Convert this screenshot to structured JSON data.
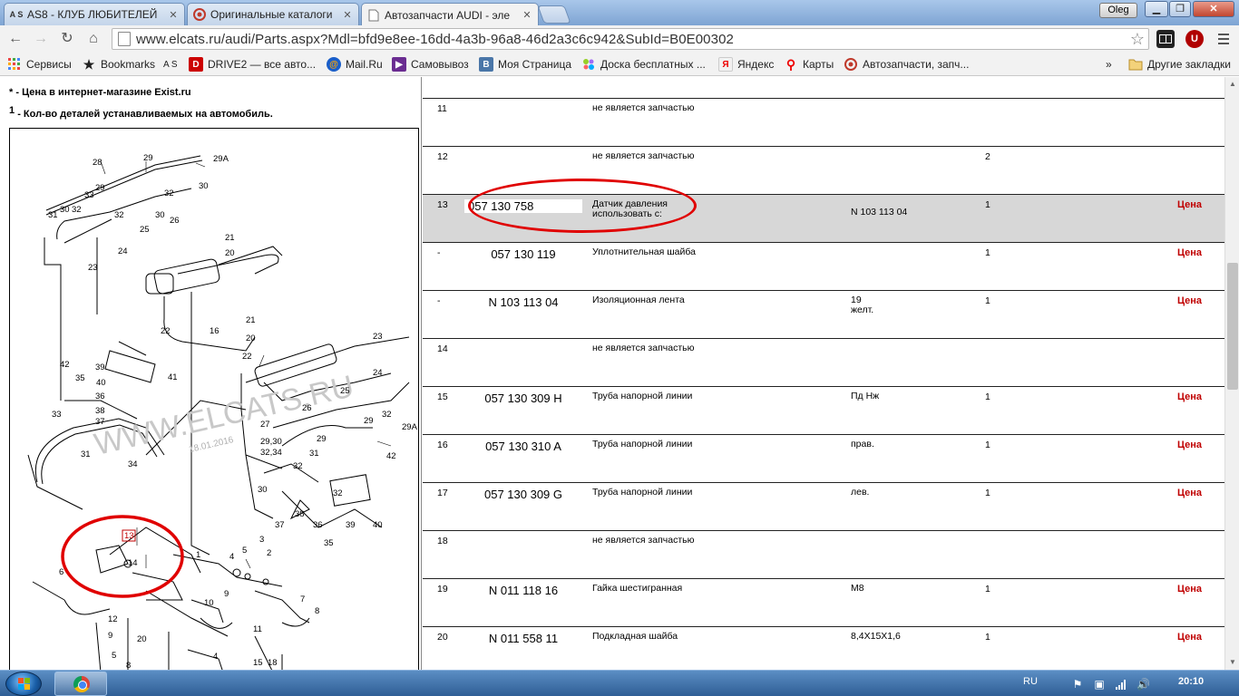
{
  "browser": {
    "tabs": [
      {
        "favicon": "A S",
        "label": "AS8 - КЛУБ ЛЮБИТЕЛЕЙ"
      },
      {
        "favicon": "exist-icon",
        "label": "Оригинальные каталоги"
      },
      {
        "favicon": "page-icon",
        "label": "Автозапчасти AUDI - эле"
      }
    ],
    "user": "Oleg",
    "url": "www.elcats.ru/audi/Parts.aspx?Mdl=bfd9e8ee-16dd-4a3b-96a8-46d2a3c6c942&SubId=B0E00302",
    "bookmarks": [
      "Сервисы",
      "Bookmarks",
      "A S",
      "DRIVE2 — все авто...",
      "Mail.Ru",
      "Самовывоз",
      "Моя Страница",
      "Доска бесплатных ...",
      "Яндекс",
      "Карты",
      "Автозапчасти, запч..."
    ],
    "bookmarks_more": "»",
    "other_bookmarks": "Другие закладки"
  },
  "notes": {
    "star_mark": "*",
    "star_text": "- Цена в интернет-магазине Exist.ru",
    "one_mark": "1",
    "one_text": "- Кол-во деталей устанавливаемых на автомобиль."
  },
  "diagram": {
    "watermark": "WWW.ELCATS.RU",
    "date": "18.01.2016",
    "callouts": [
      "28",
      "29",
      "29A",
      "30",
      "31",
      "32",
      "33",
      "34",
      "29",
      "30",
      "32",
      "30",
      "25",
      "26",
      "21",
      "20",
      "23",
      "24",
      "22",
      "16",
      "40",
      "42",
      "35",
      "39",
      "41",
      "36",
      "38",
      "37",
      "21",
      "20",
      "22",
      "23",
      "24",
      "25",
      "26",
      "29",
      "32",
      "27",
      "29,30",
      "32,34",
      "29",
      "32",
      "31",
      "32",
      "30",
      "33",
      "31",
      "34",
      "29A",
      "42",
      "37",
      "38",
      "36",
      "39",
      "40",
      "35",
      "13",
      "14",
      "1",
      "4",
      "5",
      "3",
      "2",
      "6",
      "7",
      "8",
      "9",
      "10",
      "11",
      "12",
      "9",
      "8",
      "5",
      "4",
      "15",
      "18",
      "20",
      "9"
    ]
  },
  "table": {
    "rows": [
      {
        "num": "11",
        "part": "",
        "name": "не является запчастью",
        "note": "",
        "qty": "",
        "price": ""
      },
      {
        "num": "12",
        "part": "",
        "name": "не является запчастью",
        "note": "",
        "qty": "2",
        "price": ""
      },
      {
        "num": "13",
        "part": "057 130 758",
        "name": "Датчик давления",
        "name2": "использовать с:",
        "note": "",
        "note2": "N 103 113 04",
        "qty": "1",
        "price": "Цена"
      },
      {
        "num": "-",
        "part": "057 130 119",
        "name": "Уплотнительная шайба",
        "note": "",
        "qty": "1",
        "price": "Цена"
      },
      {
        "num": "-",
        "part": "N 103 113 04",
        "name": "Изоляционная лента",
        "note": "19",
        "note_b": "желт.",
        "qty": "1",
        "price": "Цена"
      },
      {
        "num": "14",
        "part": "",
        "name": "не является запчастью",
        "note": "",
        "qty": "",
        "price": ""
      },
      {
        "num": "15",
        "part": "057 130 309 H",
        "name": "Труба напорной линии",
        "note": "Пд Нж",
        "qty": "1",
        "price": "Цена"
      },
      {
        "num": "16",
        "part": "057 130 310 A",
        "name": "Труба напорной линии",
        "note": "прав.",
        "qty": "1",
        "price": "Цена"
      },
      {
        "num": "17",
        "part": "057 130 309 G",
        "name": "Труба напорной линии",
        "note": "лев.",
        "qty": "1",
        "price": "Цена"
      },
      {
        "num": "18",
        "part": "",
        "name": "не является запчастью",
        "note": "",
        "qty": "",
        "price": ""
      },
      {
        "num": "19",
        "part": "N 011 118 16",
        "name": "Гайка шестигранная",
        "note": "M8",
        "qty": "1",
        "price": "Цена"
      },
      {
        "num": "20",
        "part": "N 011 558 11",
        "name": "Подкладная шайба",
        "note": "8,4X15X1,6",
        "qty": "1",
        "price": "Цена"
      }
    ]
  },
  "taskbar": {
    "lang": "RU",
    "time": "20:10"
  },
  "colors": {
    "price_red": "#c00000",
    "highlight_row": "#d7d7d7",
    "annotation_red": "#e00000"
  }
}
